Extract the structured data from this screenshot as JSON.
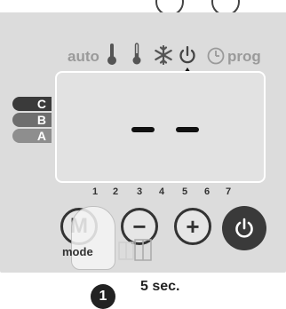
{
  "header": {
    "auto_label": "auto",
    "prog_label": "prog"
  },
  "comfort_tabs": [
    {
      "label": "C",
      "color": "#3a3a3a"
    },
    {
      "label": "B",
      "color": "#6e6e6e"
    },
    {
      "label": "A",
      "color": "#8e8e8e"
    }
  ],
  "display": {
    "dashes": "— —"
  },
  "day_numbers": [
    "1",
    "2",
    "3",
    "4",
    "5",
    "6",
    "7"
  ],
  "buttons": {
    "mode_letter": "M",
    "mode_label": "mode",
    "minus_symbol": "−",
    "plus_symbol": "+"
  },
  "instruction": {
    "step_number": "1",
    "duration_label": "5 sec."
  },
  "icons": [
    "thermometer-comfort-icon",
    "thermometer-eco-icon",
    "frost-icon",
    "standby-icon",
    "prog-clock-icon",
    "pointer-arrow-icon",
    "power-icon",
    "window-icon",
    "hand-icon"
  ]
}
